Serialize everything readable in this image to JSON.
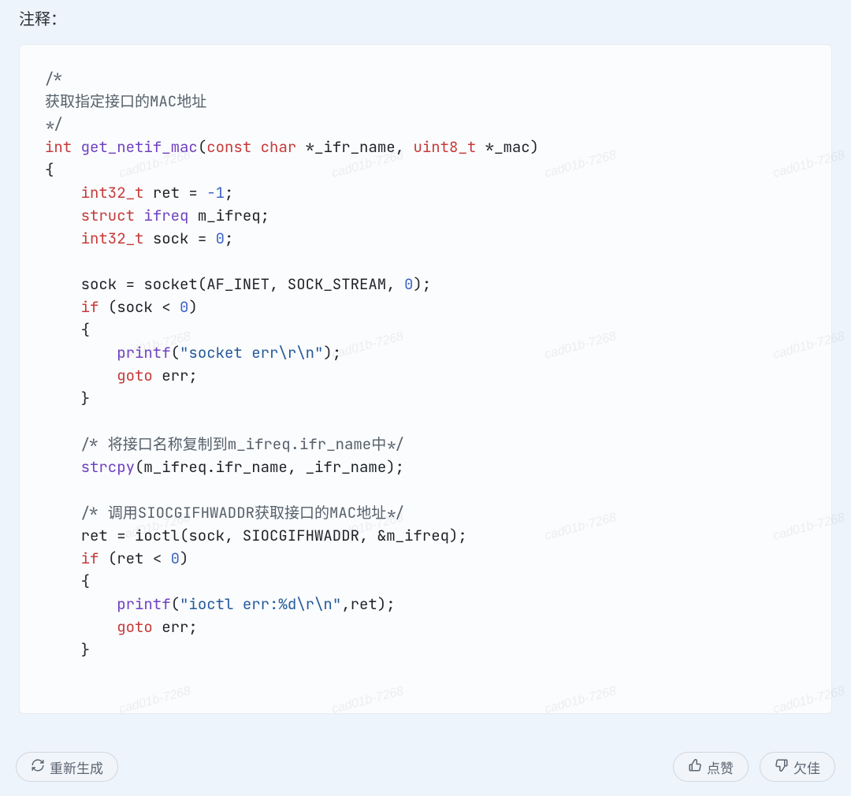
{
  "watermark": "cad01b-7268",
  "heading": "注释：",
  "buttons": {
    "regenerate": "重新生成",
    "like": "点赞",
    "dislike": "欠佳"
  },
  "code": {
    "tokens": [
      {
        "cls": "tok-cmt",
        "t": "/*"
      },
      {
        "t": "\n"
      },
      {
        "cls": "tok-cmt",
        "t": "获取指定接口的MAC地址"
      },
      {
        "t": "\n"
      },
      {
        "cls": "tok-cmt",
        "t": "*/"
      },
      {
        "t": "\n"
      },
      {
        "cls": "tok-kw",
        "t": "int"
      },
      {
        "t": " "
      },
      {
        "cls": "tok-fn",
        "t": "get_netif_mac"
      },
      {
        "t": "("
      },
      {
        "cls": "tok-kw",
        "t": "const"
      },
      {
        "t": " "
      },
      {
        "cls": "tok-kw",
        "t": "char"
      },
      {
        "t": " *_ifr_name, "
      },
      {
        "cls": "tok-kw",
        "t": "uint8_t"
      },
      {
        "t": " *_mac)"
      },
      {
        "t": "\n"
      },
      {
        "t": "{"
      },
      {
        "t": "\n"
      },
      {
        "t": "    "
      },
      {
        "cls": "tok-kw",
        "t": "int32_t"
      },
      {
        "t": " ret = "
      },
      {
        "cls": "tok-neg",
        "t": "-1"
      },
      {
        "t": ";"
      },
      {
        "t": "\n"
      },
      {
        "t": "    "
      },
      {
        "cls": "tok-kw",
        "t": "struct"
      },
      {
        "t": " "
      },
      {
        "cls": "tok-fn",
        "t": "ifreq"
      },
      {
        "t": " m_ifreq;"
      },
      {
        "t": "\n"
      },
      {
        "t": "    "
      },
      {
        "cls": "tok-kw",
        "t": "int32_t"
      },
      {
        "t": " sock = "
      },
      {
        "cls": "tok-num",
        "t": "0"
      },
      {
        "t": ";"
      },
      {
        "t": "\n"
      },
      {
        "t": "\n"
      },
      {
        "t": "    sock = socket(AF_INET, SOCK_STREAM, "
      },
      {
        "cls": "tok-num",
        "t": "0"
      },
      {
        "t": ");"
      },
      {
        "t": "\n"
      },
      {
        "t": "    "
      },
      {
        "cls": "tok-kw",
        "t": "if"
      },
      {
        "t": " (sock < "
      },
      {
        "cls": "tok-num",
        "t": "0"
      },
      {
        "t": ")"
      },
      {
        "t": "\n"
      },
      {
        "t": "    {"
      },
      {
        "t": "\n"
      },
      {
        "t": "        "
      },
      {
        "cls": "tok-call",
        "t": "printf"
      },
      {
        "t": "("
      },
      {
        "cls": "tok-str",
        "t": "\"socket err\\r\\n\""
      },
      {
        "t": ");"
      },
      {
        "t": "\n"
      },
      {
        "t": "        "
      },
      {
        "cls": "tok-kw",
        "t": "goto"
      },
      {
        "t": " err;"
      },
      {
        "t": "\n"
      },
      {
        "t": "    }"
      },
      {
        "t": "\n"
      },
      {
        "t": "\n"
      },
      {
        "t": "    "
      },
      {
        "cls": "tok-cmt",
        "t": "/* 将接口名称复制到m_ifreq.ifr_name中*/"
      },
      {
        "t": "\n"
      },
      {
        "t": "    "
      },
      {
        "cls": "tok-call",
        "t": "strcpy"
      },
      {
        "t": "(m_ifreq.ifr_name, _ifr_name);"
      },
      {
        "t": "\n"
      },
      {
        "t": "\n"
      },
      {
        "t": "    "
      },
      {
        "cls": "tok-cmt",
        "t": "/* 调用SIOCGIFHWADDR获取接口的MAC地址*/"
      },
      {
        "t": "\n"
      },
      {
        "t": "    ret = ioctl(sock, SIOCGIFHWADDR, &m_ifreq);"
      },
      {
        "t": "\n"
      },
      {
        "t": "    "
      },
      {
        "cls": "tok-kw",
        "t": "if"
      },
      {
        "t": " (ret < "
      },
      {
        "cls": "tok-num",
        "t": "0"
      },
      {
        "t": ")"
      },
      {
        "t": "\n"
      },
      {
        "t": "    {"
      },
      {
        "t": "\n"
      },
      {
        "t": "        "
      },
      {
        "cls": "tok-call",
        "t": "printf"
      },
      {
        "t": "("
      },
      {
        "cls": "tok-str",
        "t": "\"ioctl err:%d\\r\\n\""
      },
      {
        "t": ",ret);"
      },
      {
        "t": "\n"
      },
      {
        "t": "        "
      },
      {
        "cls": "tok-kw",
        "t": "goto"
      },
      {
        "t": " err;"
      },
      {
        "t": "\n"
      },
      {
        "t": "    }"
      },
      {
        "t": "\n"
      }
    ]
  }
}
